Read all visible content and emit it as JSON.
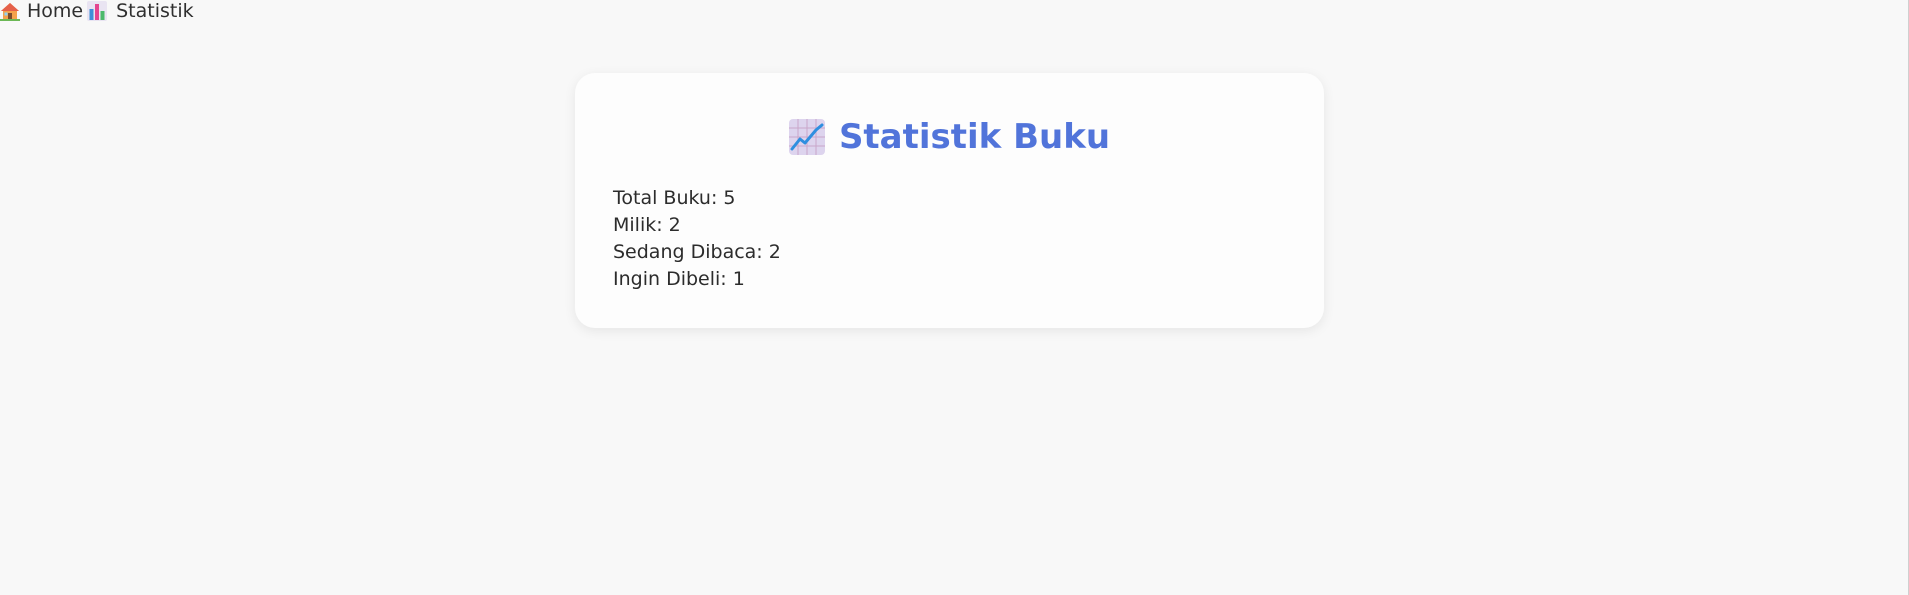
{
  "nav": {
    "home_label": "Home",
    "home_icon": "house-icon",
    "stats_label": "Statistik",
    "stats_icon": "bar-chart-icon"
  },
  "card": {
    "title": "Statistik Buku",
    "title_icon": "chart-increasing-icon",
    "title_color": "#5174da",
    "stats": [
      "Total Buku: 5",
      "Milik: 2",
      "Sedang Dibaca: 2",
      "Ingin Dibeli: 1"
    ]
  }
}
